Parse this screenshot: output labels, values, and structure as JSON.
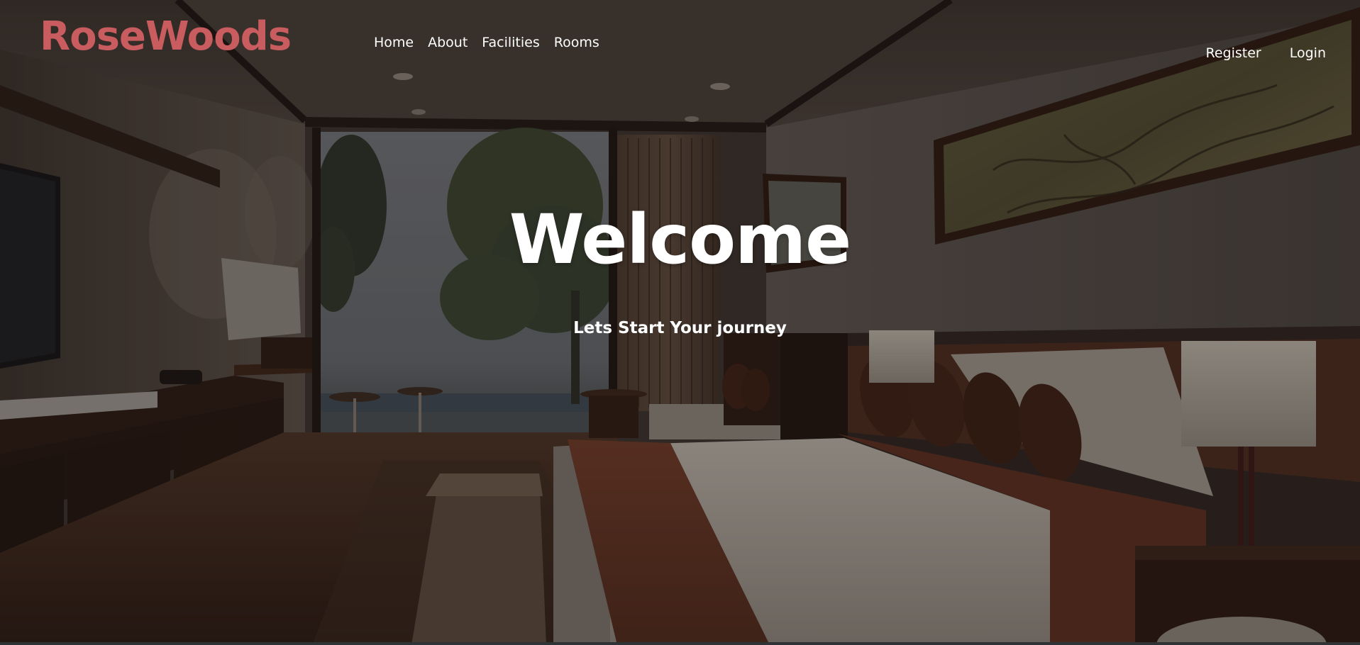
{
  "brand": {
    "name": "RoseWoods",
    "color": "#c95c5f"
  },
  "nav": {
    "items": [
      {
        "label": "Home"
      },
      {
        "label": "About"
      },
      {
        "label": "Facilities"
      },
      {
        "label": "Rooms"
      }
    ]
  },
  "auth": {
    "register_label": "Register",
    "login_label": "Login"
  },
  "hero": {
    "title": "Welcome",
    "subtitle": "Lets Start Your journey",
    "background": "dimmed hotel bedroom photo"
  }
}
